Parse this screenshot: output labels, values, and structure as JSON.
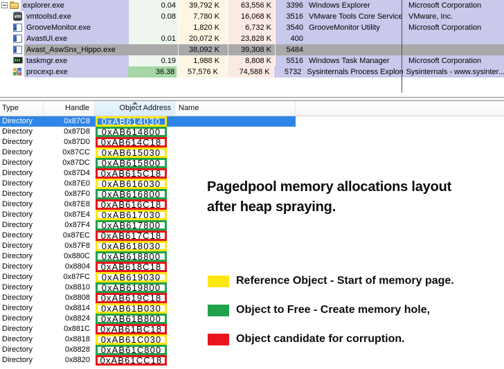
{
  "colors": {
    "lavender": "#c9c9ec",
    "selgray": "#a9a9a9",
    "selblue": "#2f85e5",
    "cpucol": "#eef6ee",
    "cpuhot": "#a5d6a5",
    "pbcol": "#fdf6e4",
    "wscol": "#fbe9e4",
    "boxyellow": "#ffe60d",
    "boxgreen": "#20a24b",
    "boxred": "#e9141d"
  },
  "process_table": {
    "rows": [
      {
        "name": "explorer.exe",
        "cpu": "0.04",
        "private_bytes": "39,792 K",
        "working_set": "63,556 K",
        "pid": "3396",
        "description": "Windows Explorer",
        "company": "Microsoft Corporation",
        "icon": "folder-icon",
        "level": 0,
        "expander": true,
        "selected": false
      },
      {
        "name": "vmtoolsd.exe",
        "cpu": "0.08",
        "private_bytes": "7,780 K",
        "working_set": "16,068 K",
        "pid": "3516",
        "description": "VMware Tools Core Service",
        "company": "VMware, Inc.",
        "icon": "vm-icon",
        "icon_text": "vm",
        "level": 1,
        "selected": false
      },
      {
        "name": "GrooveMonitor.exe",
        "cpu": "",
        "private_bytes": "1,820 K",
        "working_set": "6,732 K",
        "pid": "3540",
        "description": "GrooveMonitor Utility",
        "company": "Microsoft Corporation",
        "icon": "window-icon",
        "level": 1,
        "selected": false
      },
      {
        "name": "AvastUI.exe",
        "cpu": "0.01",
        "private_bytes": "20,072 K",
        "working_set": "23,828 K",
        "pid": "400",
        "description": "",
        "company": "",
        "icon": "window-icon",
        "level": 1,
        "selected": false
      },
      {
        "name": "Avast_AswSnx_Hippo.exe",
        "cpu": "",
        "private_bytes": "38,092 K",
        "working_set": "39,308 K",
        "pid": "5484",
        "description": "",
        "company": "",
        "icon": "window-icon",
        "level": 1,
        "selected": true
      },
      {
        "name": "taskmgr.exe",
        "cpu": "0.19",
        "private_bytes": "1,988 K",
        "working_set": "8,808 K",
        "pid": "5516",
        "description": "Windows Task Manager",
        "company": "Microsoft Corporation",
        "icon": "monitor-icon",
        "level": 1,
        "selected": false
      },
      {
        "name": "procexp.exe",
        "cpu": "36.38",
        "private_bytes": "57,576 K",
        "working_set": "74,588 K",
        "pid": "5732",
        "description": "Sysinternals Process Explorer",
        "company": "Sysinternals - www.sysinter...",
        "icon": "procexp-icon",
        "level": 1,
        "selected": false,
        "cpu_highlight": true
      }
    ]
  },
  "handle_table": {
    "columns": [
      "Type",
      "Handle",
      "Object Address",
      "Name"
    ],
    "sort_indicator": "ascending",
    "rows": [
      {
        "type": "Directory",
        "handle": "0x87C8",
        "address": "0xAB614030",
        "box": "yellow",
        "selected": true
      },
      {
        "type": "Directory",
        "handle": "0x87D8",
        "address": "0xAB614800",
        "box": "green",
        "selected": false
      },
      {
        "type": "Directory",
        "handle": "0x87D0",
        "address": "0xAB614C18",
        "box": "red",
        "selected": false
      },
      {
        "type": "Directory",
        "handle": "0x87CC",
        "address": "0xAB615030",
        "box": "yellow",
        "selected": false
      },
      {
        "type": "Directory",
        "handle": "0x87DC",
        "address": "0xAB615800",
        "box": "green",
        "selected": false
      },
      {
        "type": "Directory",
        "handle": "0x87D4",
        "address": "0xAB615C18",
        "box": "red",
        "selected": false
      },
      {
        "type": "Directory",
        "handle": "0x87E0",
        "address": "0xAB616030",
        "box": "yellow",
        "selected": false
      },
      {
        "type": "Directory",
        "handle": "0x87F0",
        "address": "0xAB616800",
        "box": "green",
        "selected": false
      },
      {
        "type": "Directory",
        "handle": "0x87E8",
        "address": "0xAB616C18",
        "box": "red",
        "selected": false
      },
      {
        "type": "Directory",
        "handle": "0x87E4",
        "address": "0xAB617030",
        "box": "yellow",
        "selected": false
      },
      {
        "type": "Directory",
        "handle": "0x87F4",
        "address": "0xAB617800",
        "box": "green",
        "selected": false
      },
      {
        "type": "Directory",
        "handle": "0x87EC",
        "address": "0xAB617C18",
        "box": "red",
        "selected": false
      },
      {
        "type": "Directory",
        "handle": "0x87F8",
        "address": "0xAB618030",
        "box": "yellow",
        "selected": false
      },
      {
        "type": "Directory",
        "handle": "0x880C",
        "address": "0xAB618800",
        "box": "green",
        "selected": false
      },
      {
        "type": "Directory",
        "handle": "0x8804",
        "address": "0xAB618C18",
        "box": "red",
        "selected": false
      },
      {
        "type": "Directory",
        "handle": "0x87FC",
        "address": "0xAB619030",
        "box": "yellow",
        "selected": false
      },
      {
        "type": "Directory",
        "handle": "0x8810",
        "address": "0xAB619800",
        "box": "green",
        "selected": false
      },
      {
        "type": "Directory",
        "handle": "0x8808",
        "address": "0xAB619C18",
        "box": "red",
        "selected": false
      },
      {
        "type": "Directory",
        "handle": "0x8814",
        "address": "0xAB61B030",
        "box": "yellow",
        "selected": false
      },
      {
        "type": "Directory",
        "handle": "0x8824",
        "address": "0xAB61B800",
        "box": "green",
        "selected": false
      },
      {
        "type": "Directory",
        "handle": "0x881C",
        "address": "0xAB61BC18",
        "box": "red",
        "selected": false
      },
      {
        "type": "Directory",
        "handle": "0x8818",
        "address": "0xAB61C030",
        "box": "yellow",
        "selected": false
      },
      {
        "type": "Directory",
        "handle": "0x8828",
        "address": "0xAB61C800",
        "box": "green",
        "selected": false
      },
      {
        "type": "Directory",
        "handle": "0x8820",
        "address": "0xAB61CC18",
        "box": "red",
        "selected": false
      }
    ]
  },
  "annotation": {
    "title_line1": "Pagedpool memory allocations layout",
    "title_line2": "after heap spraying.",
    "legend": [
      {
        "color": "#ffe60d",
        "label": "Reference Object - Start of memory page."
      },
      {
        "color": "#20a24b",
        "label": "Object to Free - Create memory hole,"
      },
      {
        "color": "#e9141d",
        "label": "Object candidate for corruption."
      }
    ]
  }
}
